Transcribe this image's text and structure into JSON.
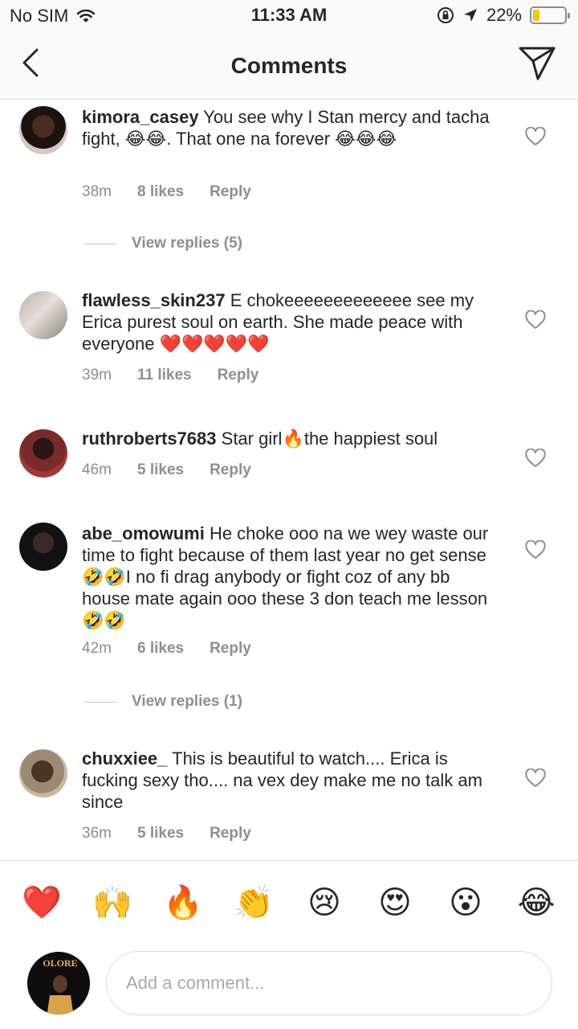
{
  "status_bar": {
    "carrier": "No SIM",
    "time": "11:33 AM",
    "battery_percent": "22%",
    "battery_level": 0.22
  },
  "header": {
    "title": "Comments"
  },
  "comments": [
    {
      "username": "kimora_casey",
      "text": "You see why I Stan mercy and tacha fight, 😂😂. That one na forever 😂😂😂",
      "time": "38m",
      "likes": "8 likes",
      "reply": "Reply",
      "view_replies": "View replies (5)"
    },
    {
      "username": "flawless_skin237",
      "text": "E chokeeeeeeeeeeeee see my Erica purest soul on earth. She made peace with everyone ❤️❤️❤️❤️❤️",
      "time": "39m",
      "likes": "11 likes",
      "reply": "Reply"
    },
    {
      "username": "ruthroberts7683",
      "text": "Star girl🔥the happiest soul",
      "time": "46m",
      "likes": "5 likes",
      "reply": "Reply"
    },
    {
      "username": "abe_omowumi",
      "text": "He choke ooo na we wey waste our time to fight because of them last year no get sense 🤣🤣I no fi drag anybody or fight coz of any bb house mate again ooo these 3 don teach me lesson🤣🤣",
      "time": "42m",
      "likes": "6 likes",
      "reply": "Reply",
      "view_replies": "View replies (1)"
    },
    {
      "username": "chuxxiee_",
      "text": "This is beautiful to watch.... Erica is fucking sexy tho.... na vex dey make me no talk am since",
      "time": "36m",
      "likes": "5 likes",
      "reply": "Reply"
    }
  ],
  "emoji_bar": [
    "❤️",
    "🙌",
    "🔥",
    "👏",
    "😢",
    "😍",
    "😮",
    "😂"
  ],
  "composer": {
    "placeholder": "Add a comment...",
    "avatar_text": "OLORE"
  },
  "colors": {
    "accent_battery": "#f5c518",
    "muted": "#8e8e8e",
    "text": "#262626"
  }
}
